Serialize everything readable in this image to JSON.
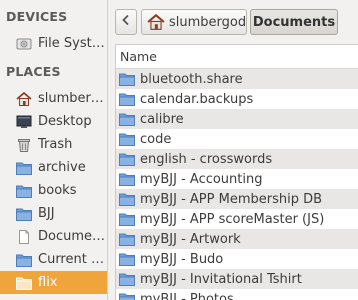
{
  "sidebar": {
    "devices_title": "DEVICES",
    "devices": [
      {
        "label": "File Syste...",
        "icon": "drive-icon"
      }
    ],
    "places_title": "PLACES",
    "places": [
      {
        "label": "slumberg...",
        "icon": "home-icon"
      },
      {
        "label": "Desktop",
        "icon": "desktop-icon"
      },
      {
        "label": "Trash",
        "icon": "trash-icon"
      },
      {
        "label": "archive",
        "icon": "folder-icon"
      },
      {
        "label": "books",
        "icon": "folder-icon"
      },
      {
        "label": "BJJ",
        "icon": "folder-icon"
      },
      {
        "label": "Documen...",
        "icon": "document-icon"
      },
      {
        "label": "Current A...",
        "icon": "folder-icon"
      },
      {
        "label": "flix",
        "icon": "folder-icon",
        "selected": true
      }
    ]
  },
  "pathbar": {
    "home_label": "slumbergod",
    "current_label": "Documents"
  },
  "list": {
    "column_name": "Name",
    "rows": [
      "bluetooth.share",
      "calendar.backups",
      "calibre",
      "code",
      "english - crosswords",
      "myBJJ - Accounting",
      "myBJJ - APP Membership DB",
      "myBJJ - APP scoreMaster (JS)",
      "myBJJ - Artwork",
      "myBJJ - Budo",
      "myBJJ - Invitational Tshirt",
      "myBJJ - Photos"
    ]
  },
  "colors": {
    "selected": "#f0a43c",
    "folder": "#6f9fd8",
    "row_alt": "#e8e7e5"
  }
}
